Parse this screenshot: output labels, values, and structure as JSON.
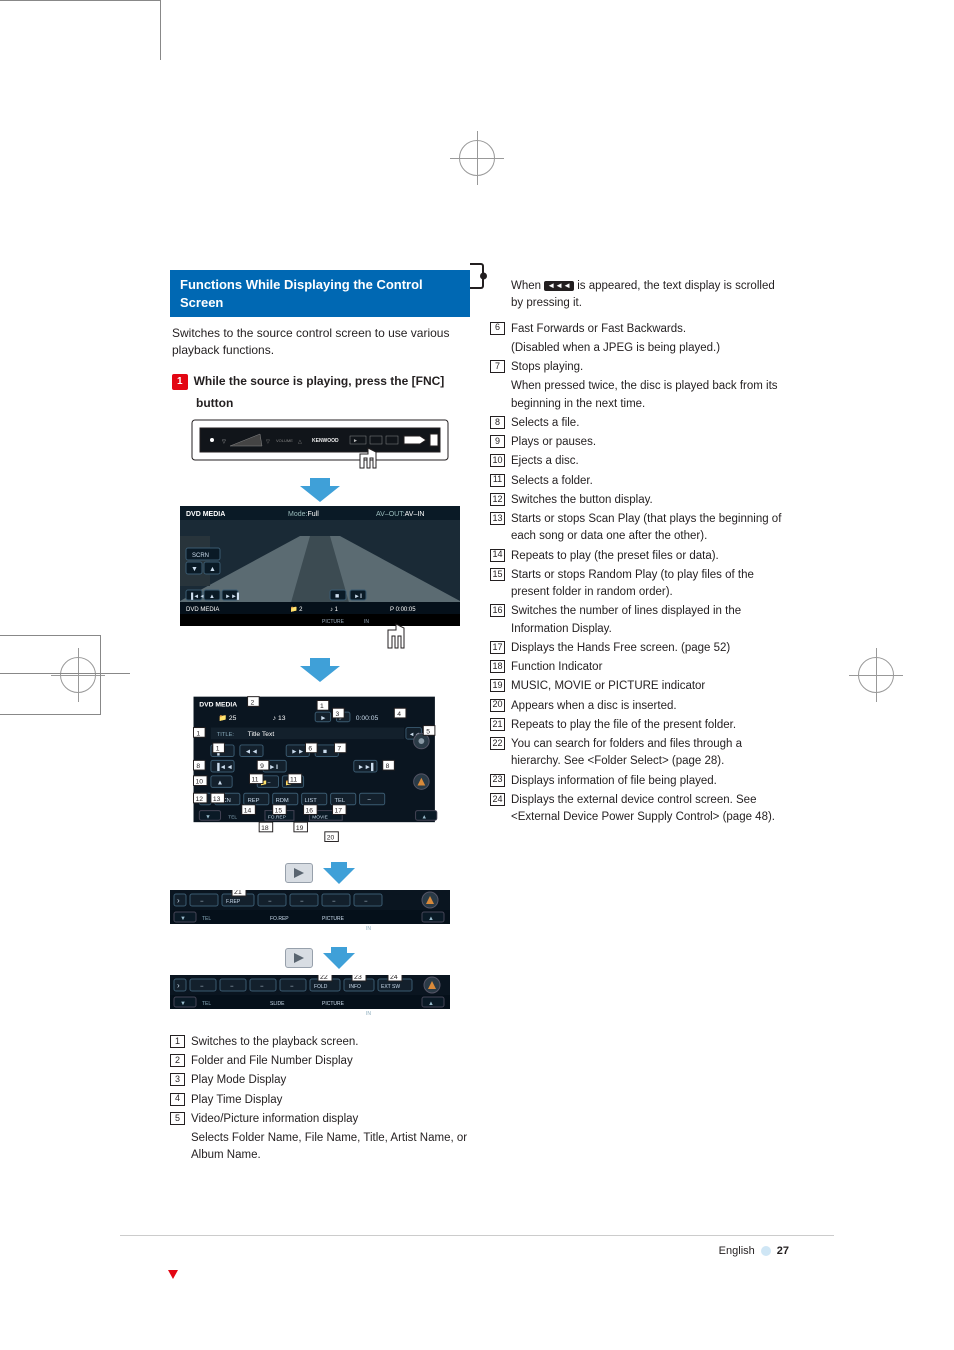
{
  "heading": "Functions While Displaying the Control Screen",
  "lead": "Switches to the source control screen to use various playback functions.",
  "step": {
    "num": "1",
    "text_a": "While the source is playing, press the [FNC]",
    "text_b": "button"
  },
  "overlay": {
    "source": "DVD MEDIA",
    "mode_lbl": "Mode:",
    "mode_val": "Full",
    "avout_lbl": "AV–OUT:",
    "avout_val": "AV–IN",
    "scrn": "SCRN",
    "status_left": "DVD MEDIA",
    "chapter": "2",
    "track": "1",
    "playmode": "P",
    "time": "0:00:05",
    "in": "IN",
    "picture": "PICTURE"
  },
  "panel": {
    "source": "DVD MEDIA",
    "folder_no": "25",
    "file_no": "13",
    "pm": "P",
    "time": "0:00:05",
    "title_lbl": "TITLE:",
    "title_val": "Title Text",
    "btn_scn": "SCN",
    "btn_rep": "REP",
    "btn_rdm": "RDM",
    "btn_list": "LIST",
    "btn_tel": "TEL",
    "btn_forep": "FO.REP",
    "tel": "TEL",
    "mover": "MOVIE"
  },
  "bar1": {
    "frep": "F.REP",
    "forep": "FO.REP",
    "picture": "PICTURE",
    "in": "IN",
    "tel": "TEL"
  },
  "bar2": {
    "fold": "FOLD",
    "info": "INFO",
    "extsw": "EXT SW",
    "slide": "SLIDE",
    "picture": "PICTURE",
    "in": "IN",
    "tel": "TEL"
  },
  "left_items": [
    {
      "n": "1",
      "t": "Switches to the playback screen."
    },
    {
      "n": "2",
      "t": "Folder and File Number Display"
    },
    {
      "n": "3",
      "t": "Play Mode Display"
    },
    {
      "n": "4",
      "t": "Play Time Display"
    },
    {
      "n": "5",
      "t": "Video/Picture information display"
    }
  ],
  "left_sub": "Selects Folder Name, File Name, Title, Artist Name, or Album Name.",
  "right_pre_sub_a": "When ",
  "right_pre_sub_b": " is appeared, the text display is scrolled by pressing it.",
  "right_items": [
    {
      "n": "6",
      "t": "Fast Forwards or Fast Backwards.",
      "sub": "(Disabled when a JPEG is being played.)"
    },
    {
      "n": "7",
      "t": "Stops playing.",
      "sub": "When pressed twice, the disc is played back from its beginning in the next time."
    },
    {
      "n": "8",
      "t": "Selects a file."
    },
    {
      "n": "9",
      "t": "Plays or pauses."
    },
    {
      "n": "10",
      "t": "Ejects a disc."
    },
    {
      "n": "11",
      "t": "Selects a folder."
    },
    {
      "n": "12",
      "t": "Switches the button display."
    },
    {
      "n": "13",
      "t": "Starts or stops Scan Play (that plays the beginning of each song or data one after the other)."
    },
    {
      "n": "14",
      "t": "Repeats to play (the preset files or data)."
    },
    {
      "n": "15",
      "t": "Starts or stops Random Play (to play files of the present folder in random order)."
    },
    {
      "n": "16",
      "t": "Switches the number of lines displayed in the Information Display."
    },
    {
      "n": "17",
      "t": "Displays the Hands Free screen. (page 52)"
    },
    {
      "n": "18",
      "t": "Function Indicator"
    },
    {
      "n": "19",
      "t": "MUSIC, MOVIE or PICTURE indicator"
    },
    {
      "n": "20",
      "t": "Appears when a disc is inserted."
    },
    {
      "n": "21",
      "t": "Repeats to play the file of the present folder."
    },
    {
      "n": "22",
      "t": "You can search for folders and files through a hierarchy. See <Folder Select> (page 28)."
    },
    {
      "n": "23",
      "t": "Displays information of file being played."
    },
    {
      "n": "24",
      "t": "Displays the external device control screen. See <External Device Power Supply Control> (page 48)."
    }
  ],
  "footer": {
    "lang": "English",
    "page": "27"
  }
}
